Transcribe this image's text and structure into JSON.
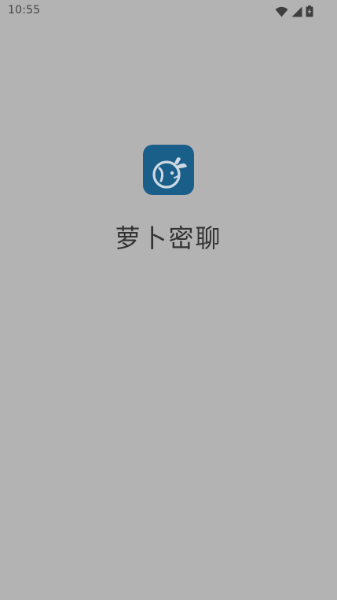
{
  "status_bar": {
    "time": "10:55",
    "icons": [
      "wifi-icon",
      "signal-icon",
      "battery-charging-icon"
    ]
  },
  "splash": {
    "app_icon": "radish-logo-icon",
    "app_name": "萝卜密聊"
  },
  "colors": {
    "background": "#b3b3b3",
    "icon_background": "#1a5e8a",
    "icon_foreground": "#cfd9e3",
    "text": "#333333"
  }
}
